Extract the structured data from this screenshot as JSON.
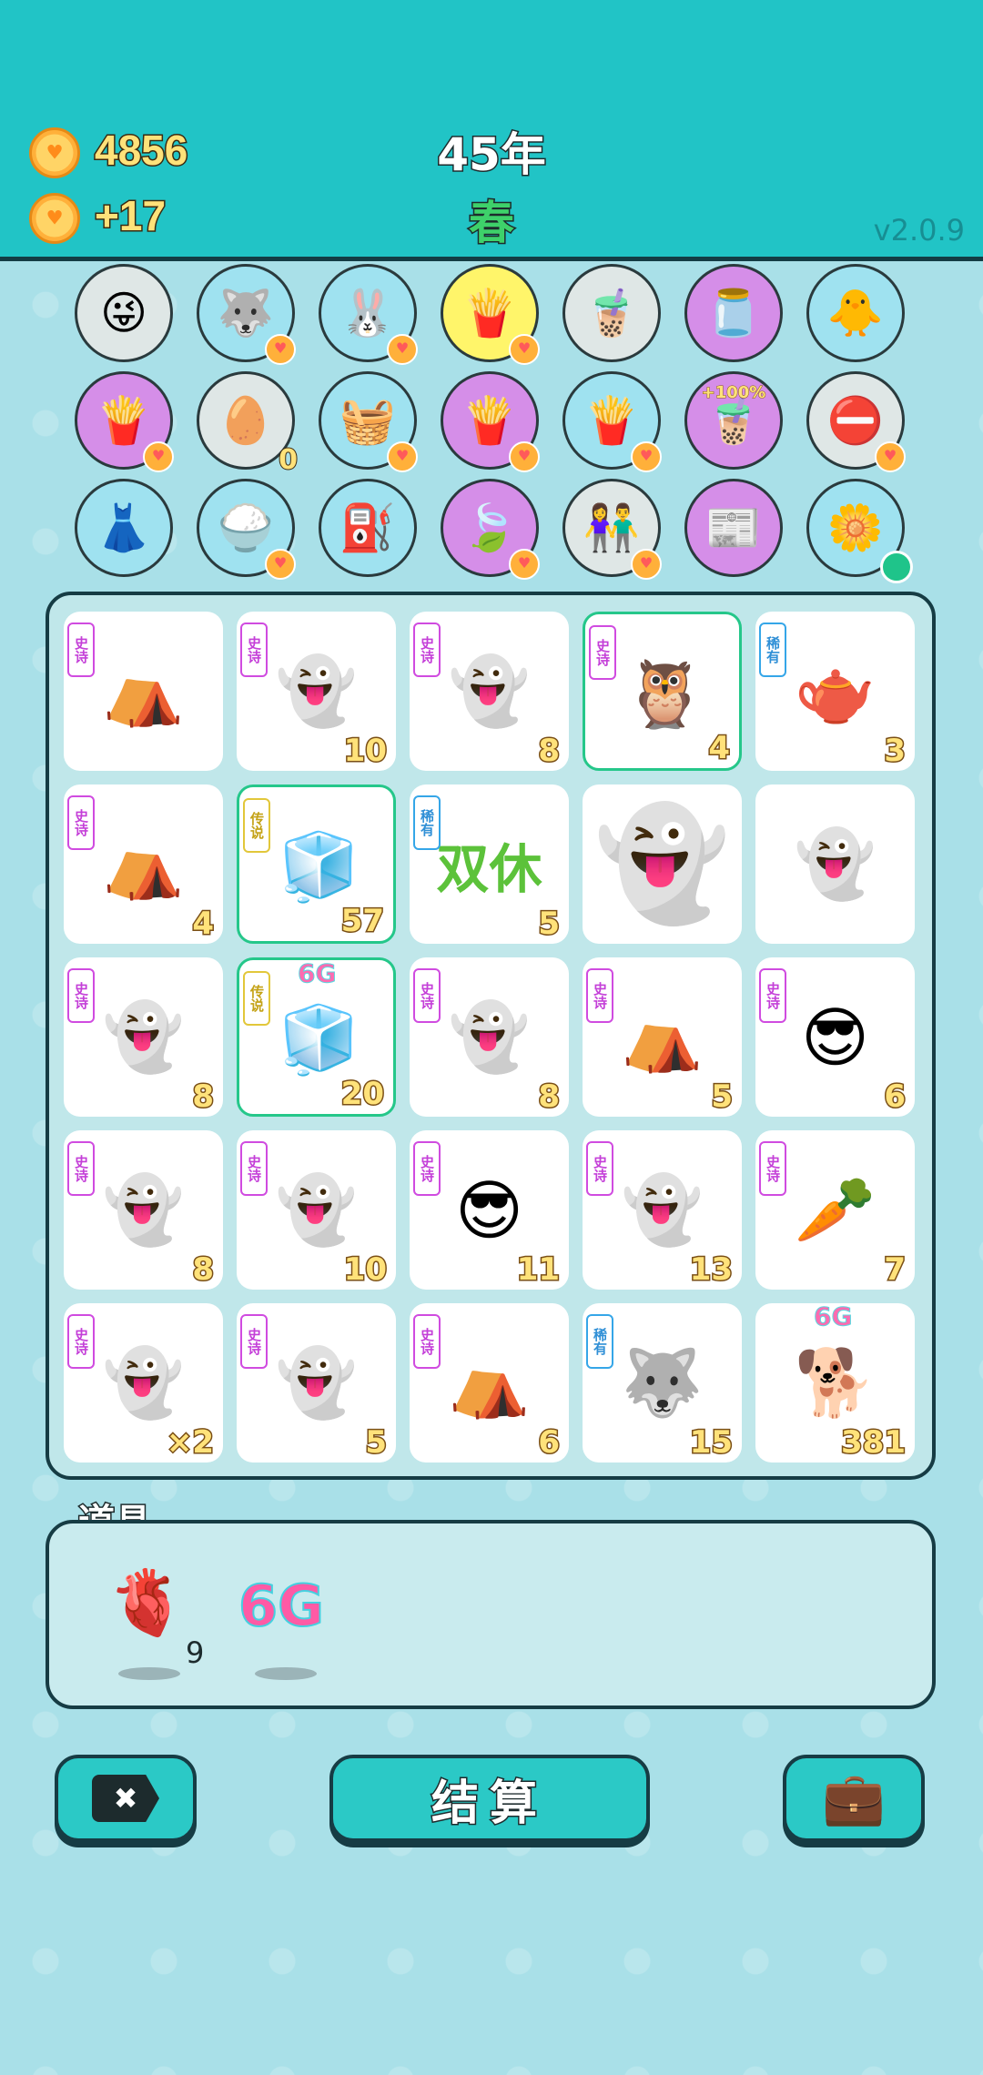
{
  "header": {
    "coins": "4856",
    "income": "+17",
    "year": "45年",
    "season": "春",
    "version": "v2.0.9"
  },
  "items": [
    {
      "icon": "ghost-wink-icon",
      "glyph": "😜",
      "bg": "#dfe7e6"
    },
    {
      "icon": "husky-icon",
      "glyph": "🐺",
      "bg": "#9fe2f0",
      "badge": "♥"
    },
    {
      "icon": "rabbit-icon",
      "glyph": "🐰",
      "bg": "#9fe2f0",
      "badge": "♥"
    },
    {
      "icon": "fries-icon",
      "glyph": "🍟",
      "bg": "#fff56a",
      "badge": "♥"
    },
    {
      "icon": "bubble-tea-icon",
      "glyph": "🧋",
      "bg": "#dfe7e6"
    },
    {
      "icon": "jar-icon",
      "glyph": "🫙",
      "bg": "#d58ee8"
    },
    {
      "icon": "chick-egg-icon",
      "glyph": "🐥",
      "bg": "#9fe2f0"
    },
    {
      "icon": "fries-icon",
      "glyph": "🍟",
      "bg": "#d58ee8",
      "badge": "♥"
    },
    {
      "icon": "egg-tray-icon",
      "glyph": "🥚",
      "bg": "#dfe7e6",
      "num": "0"
    },
    {
      "icon": "fruit-basket-icon",
      "glyph": "🧺",
      "bg": "#9fe2f0",
      "badge": "♥"
    },
    {
      "icon": "fries-icon",
      "glyph": "🍟",
      "bg": "#d58ee8",
      "badge": "♥"
    },
    {
      "icon": "fries-icon",
      "glyph": "🍟",
      "bg": "#9fe2f0",
      "badge": "♥"
    },
    {
      "icon": "bubble-tea-icon",
      "glyph": "🧋",
      "bg": "#d58ee8",
      "pct": "+100%"
    },
    {
      "icon": "no-entry-icon",
      "glyph": "⛔",
      "bg": "#dfe7e6",
      "badge": "♥"
    },
    {
      "icon": "skirt-icon",
      "glyph": "👗",
      "bg": "#9fe2f0"
    },
    {
      "icon": "rice-bowl-icon",
      "glyph": "🍚",
      "bg": "#9fe2f0",
      "badge": "♥"
    },
    {
      "icon": "pump-icon",
      "glyph": "⛽",
      "bg": "#9fe2f0"
    },
    {
      "icon": "leaf-icon",
      "glyph": "🍃",
      "bg": "#d58ee8",
      "badge": "♥"
    },
    {
      "icon": "couple-icon",
      "glyph": "👫",
      "bg": "#dfe7e6",
      "badge": "♥"
    },
    {
      "icon": "magazine-icon",
      "glyph": "📰",
      "bg": "#d58ee8"
    },
    {
      "icon": "flower-pot-icon",
      "glyph": "🌼",
      "bg": "#9fe2f0",
      "dot": true
    }
  ],
  "board": [
    {
      "tag": "史诗",
      "cls": "",
      "icon": "tent-icon",
      "glyph": "⛺",
      "count": ""
    },
    {
      "tag": "史诗",
      "cls": "",
      "icon": "ghost-icon",
      "glyph": "👻",
      "count": "10"
    },
    {
      "tag": "史诗",
      "cls": "",
      "icon": "ghost-icon",
      "glyph": "👻",
      "count": "8"
    },
    {
      "tag": "史诗",
      "cls": "",
      "icon": "owl-icon",
      "glyph": "🦉",
      "count": "4",
      "hl": true
    },
    {
      "tag": "稀有",
      "cls": "rare",
      "icon": "teapot-icon",
      "glyph": "🫖",
      "count": "3"
    },
    {
      "tag": "史诗",
      "cls": "",
      "icon": "tent-icon",
      "glyph": "⛺",
      "count": "4"
    },
    {
      "tag": "传说",
      "cls": "leg",
      "icon": "fridge-icon",
      "glyph": "🧊",
      "count": "57",
      "hl": true
    },
    {
      "tag": "稀有",
      "cls": "rare",
      "icon": "double-rest-icon",
      "text": "双休",
      "count": "5"
    },
    {
      "tag": "",
      "cls": "",
      "icon": "ghost-icon",
      "glyph": "👻",
      "count": "",
      "big": true
    },
    {
      "tag": "",
      "cls": "",
      "icon": "ghost-icon",
      "glyph": "👻",
      "count": ""
    },
    {
      "tag": "史诗",
      "cls": "",
      "icon": "ghost-icon",
      "glyph": "👻",
      "count": "8"
    },
    {
      "tag": "传说",
      "cls": "leg",
      "icon": "fridge-icon",
      "glyph": "🧊",
      "count": "20",
      "hl": true,
      "sixg": "6G"
    },
    {
      "tag": "史诗",
      "cls": "",
      "icon": "ghost-icon",
      "glyph": "👻",
      "count": "8"
    },
    {
      "tag": "史诗",
      "cls": "",
      "icon": "tent-icon",
      "glyph": "⛺",
      "count": "5"
    },
    {
      "tag": "史诗",
      "cls": "",
      "icon": "man-face-icon",
      "glyph": "😎",
      "count": "6"
    },
    {
      "tag": "史诗",
      "cls": "",
      "icon": "ghost-icon",
      "glyph": "👻",
      "count": "8"
    },
    {
      "tag": "史诗",
      "cls": "",
      "icon": "ghost-icon",
      "glyph": "👻",
      "count": "10"
    },
    {
      "tag": "史诗",
      "cls": "",
      "icon": "man-face-icon",
      "glyph": "😎",
      "count": "11"
    },
    {
      "tag": "史诗",
      "cls": "",
      "icon": "ghost-icon",
      "glyph": "👻",
      "count": "13"
    },
    {
      "tag": "史诗",
      "cls": "",
      "icon": "carrot-icon",
      "glyph": "🥕",
      "count": "7"
    },
    {
      "tag": "史诗",
      "cls": "",
      "icon": "ghost-icon",
      "glyph": "👻",
      "count": "×2"
    },
    {
      "tag": "史诗",
      "cls": "",
      "icon": "ghost-icon",
      "glyph": "👻",
      "count": "5"
    },
    {
      "tag": "史诗",
      "cls": "",
      "icon": "tent-icon",
      "glyph": "⛺",
      "count": "6"
    },
    {
      "tag": "稀有",
      "cls": "rare",
      "icon": "husky-icon",
      "glyph": "🐺",
      "count": "15"
    },
    {
      "tag": "",
      "cls": "",
      "icon": "husky-coins-icon",
      "glyph": "🐕",
      "count": "381",
      "sixg": "6G"
    }
  ],
  "props": {
    "title": "道具",
    "liver_count": "9",
    "sixg_label": "6G"
  },
  "buttons": {
    "remove_glyph": "✖",
    "settle_label": "结算",
    "bag_glyph": "💼"
  },
  "colors": {
    "header_bg": "#21c4c6",
    "button_bg": "#2bc9c6",
    "epic": "#c43fd8",
    "rare": "#2f8fd6",
    "legend": "#c4a216"
  }
}
